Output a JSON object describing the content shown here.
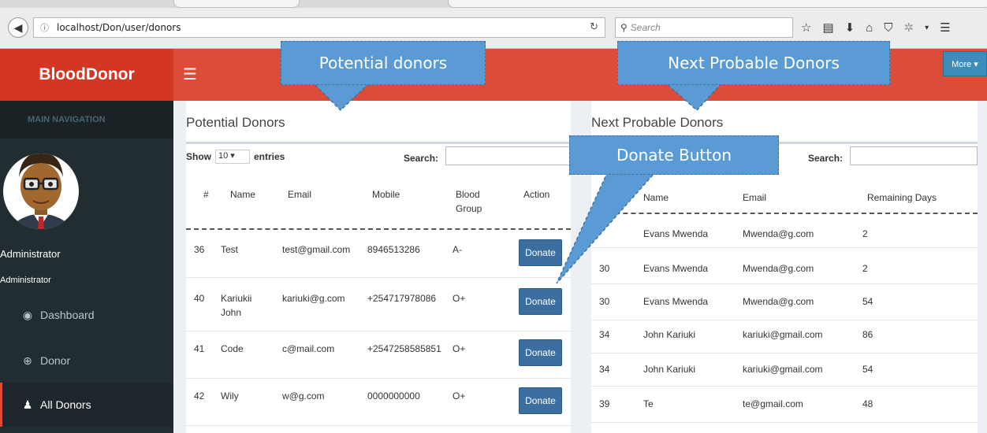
{
  "browser": {
    "url": "localhost/Don/user/donors",
    "search_placeholder": "Search"
  },
  "app": {
    "brand": "BloodDonor",
    "more_label": "More ▾"
  },
  "sidebar": {
    "header": "MAIN NAVIGATION",
    "user_name": "Administrator",
    "user_role": "Administrator",
    "items": [
      {
        "label": "Dashboard",
        "icon": "dashboard-icon"
      },
      {
        "label": "Donor",
        "icon": "life-ring-icon"
      },
      {
        "label": "All Donors",
        "icon": "user-icon"
      }
    ]
  },
  "potential": {
    "title": "Potential Donors",
    "show_label": "Show",
    "entries_value": "10",
    "entries_label": "entries",
    "search_label": "Search:",
    "headers": [
      "#",
      "Name",
      "Email",
      "Mobile",
      "Blood Group",
      "Action"
    ],
    "rows": [
      {
        "id": "36",
        "name": "Test",
        "email": "test@gmail.com",
        "mobile": "8946513286",
        "blood": "A-",
        "action": "Donate"
      },
      {
        "id": "40",
        "name": "Kariukii John",
        "email": "kariuki@g.com",
        "mobile": "+254717978086",
        "blood": "O+",
        "action": "Donate"
      },
      {
        "id": "41",
        "name": "Code",
        "email": "c@mail.com",
        "mobile": "+2547258585851",
        "blood": "O+",
        "action": "Donate"
      },
      {
        "id": "42",
        "name": "Wily",
        "email": "w@g.com",
        "mobile": "0000000000",
        "blood": "O+",
        "action": "Donate"
      }
    ]
  },
  "probable": {
    "title": "Next Probable Donors",
    "search_label": "Search:",
    "headers": [
      "Name",
      "Email",
      "Remaining Days"
    ],
    "rows": [
      {
        "id": "",
        "name": "Evans Mwenda",
        "email": "Mwenda@g.com",
        "days": "2"
      },
      {
        "id": "30",
        "name": "Evans Mwenda",
        "email": "Mwenda@g.com",
        "days": "2"
      },
      {
        "id": "30",
        "name": "Evans Mwenda",
        "email": "Mwenda@g.com",
        "days": "54"
      },
      {
        "id": "34",
        "name": "John Kariuki",
        "email": "kariuki@gmail.com",
        "days": "86"
      },
      {
        "id": "34",
        "name": "John Kariuki",
        "email": "kariuki@gmail.com",
        "days": "54"
      },
      {
        "id": "39",
        "name": "Te",
        "email": "te@gmail.com",
        "days": "48"
      }
    ]
  },
  "callouts": {
    "potential": "Potential donors",
    "probable": "Next Probable Donors",
    "donate": "Donate Button"
  },
  "colors": {
    "brand_red": "#d33724",
    "header_red": "#dd4b39",
    "sidebar_dark": "#222d32",
    "button_blue": "#3c6ea0",
    "callout_blue": "#5b9bd5"
  }
}
